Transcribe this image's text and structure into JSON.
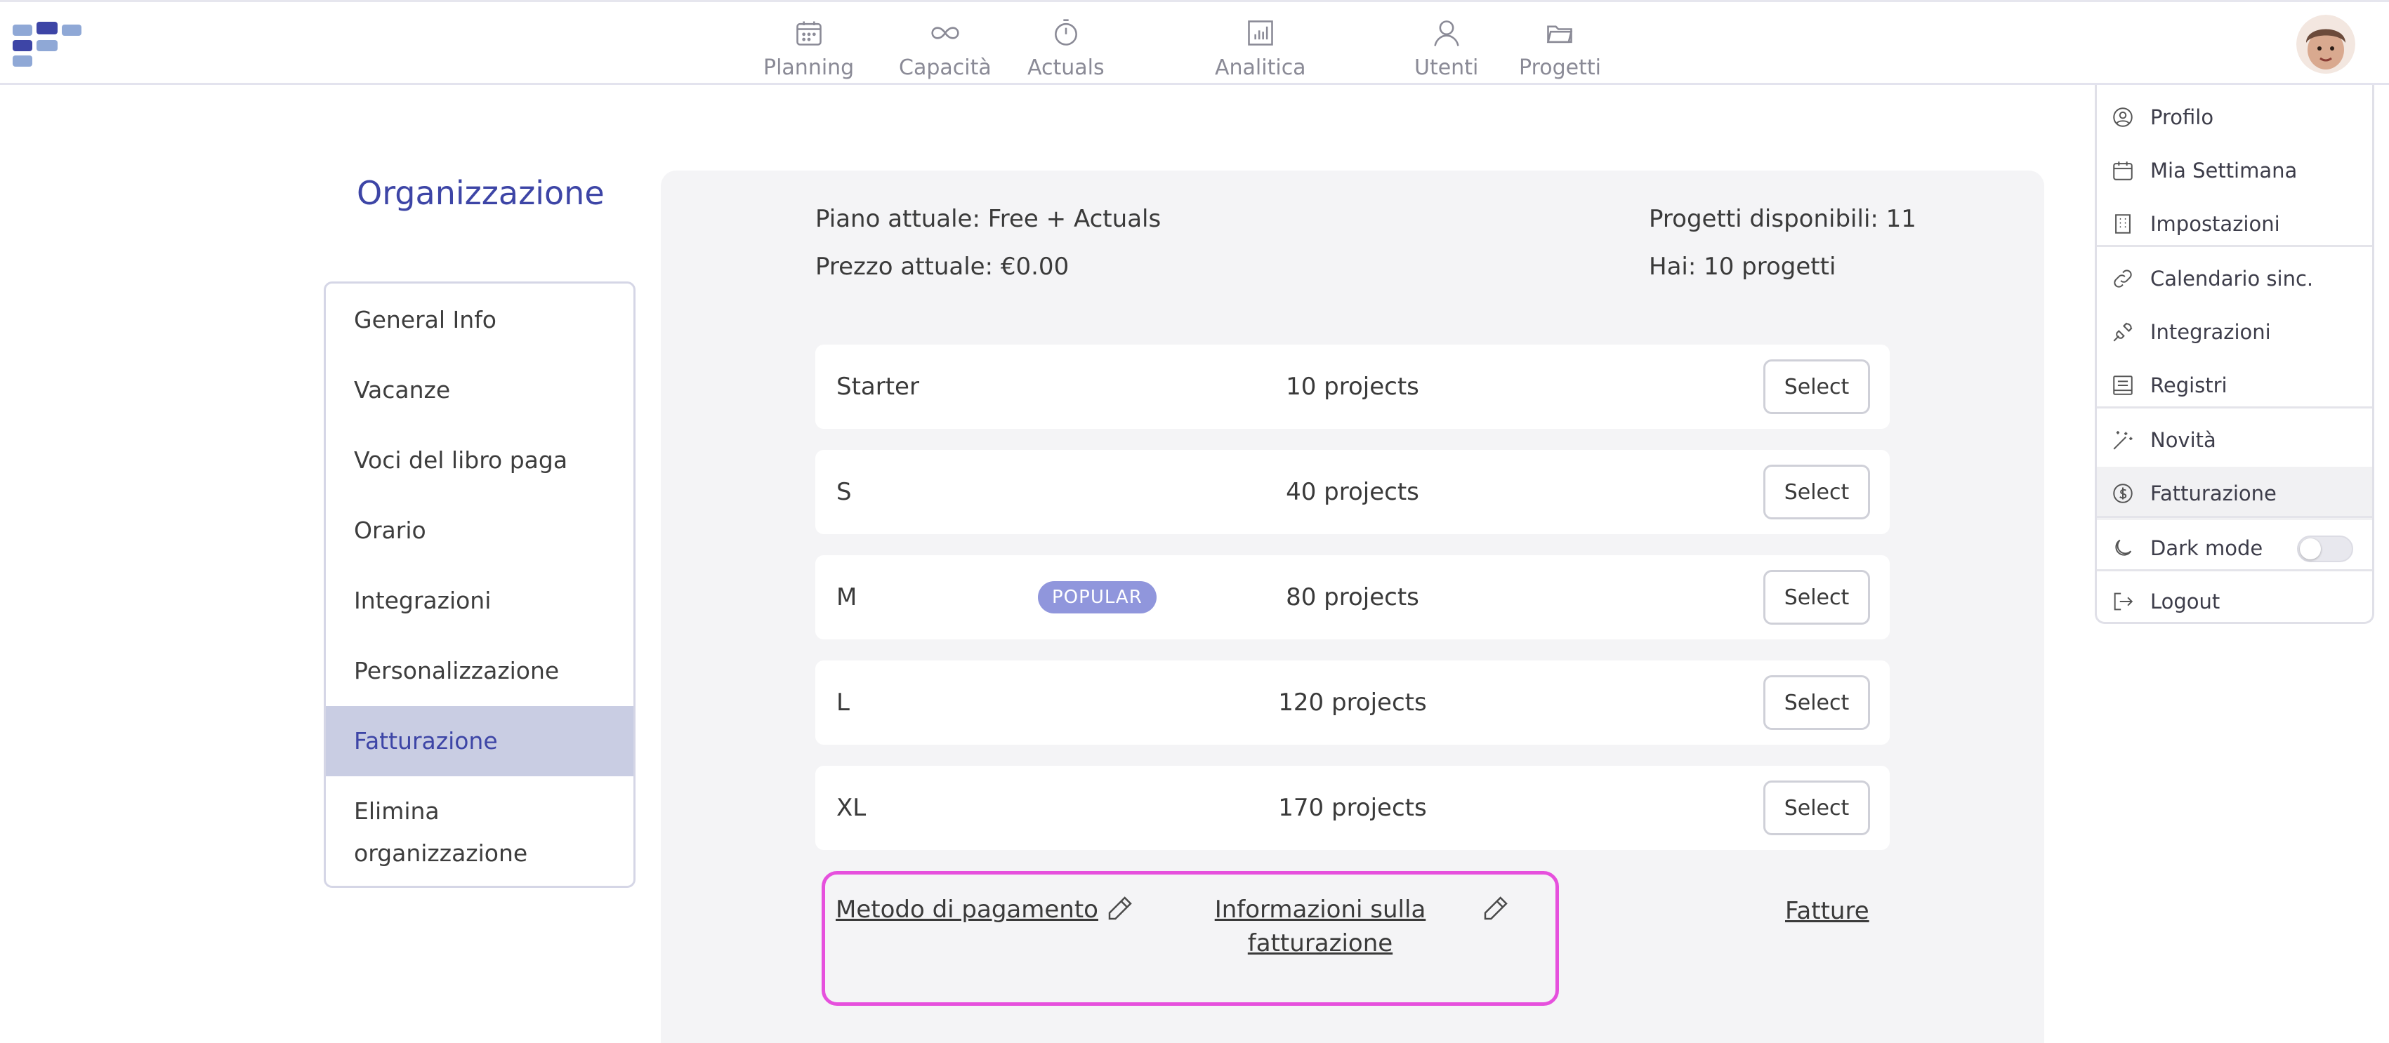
{
  "nav": {
    "items": [
      {
        "label": "Planning",
        "icon": "calendar-icon"
      },
      {
        "label": "Capacità",
        "icon": "infinity-icon"
      },
      {
        "label": "Actuals",
        "icon": "stopwatch-icon"
      },
      {
        "label": "Analitica",
        "icon": "bar-chart-icon"
      },
      {
        "label": "Utenti",
        "icon": "user-icon"
      },
      {
        "label": "Progetti",
        "icon": "folder-icon"
      }
    ]
  },
  "org": {
    "title": "Organizzazione",
    "menu": [
      {
        "label": "General Info"
      },
      {
        "label": "Vacanze"
      },
      {
        "label": "Voci del libro paga"
      },
      {
        "label": "Orario"
      },
      {
        "label": "Integrazioni"
      },
      {
        "label": "Personalizzazione"
      },
      {
        "label": "Fatturazione",
        "active": true
      },
      {
        "label": "Elimina organizzazione"
      }
    ]
  },
  "billing": {
    "current_plan": "Piano attuale: Free + Actuals",
    "current_price": "Prezzo attuale: €0.00",
    "available_projects": "Progetti disponibili: 11",
    "you_have": "Hai: 10 progetti",
    "plans": [
      {
        "name": "Starter",
        "projects": "10 projects",
        "button": "Select"
      },
      {
        "name": "S",
        "projects": "40 projects",
        "button": "Select"
      },
      {
        "name": "M",
        "projects": "80 projects",
        "button": "Select",
        "badge": "POPULAR"
      },
      {
        "name": "L",
        "projects": "120 projects",
        "button": "Select"
      },
      {
        "name": "XL",
        "projects": "170 projects",
        "button": "Select"
      }
    ],
    "payment_method": "Metodo di pagamento",
    "billing_info": "Informazioni sulla fatturazione",
    "invoices": "Fatture"
  },
  "dropdown": {
    "items": [
      {
        "label": "Profilo",
        "icon": "user-circle-icon"
      },
      {
        "label": "Mia Settimana",
        "icon": "calendar-icon"
      },
      {
        "label": "Impostazioni",
        "icon": "building-icon"
      },
      {
        "label": "Calendario sinc.",
        "icon": "link-icon"
      },
      {
        "label": "Integrazioni",
        "icon": "plug-icon"
      },
      {
        "label": "Registri",
        "icon": "log-icon"
      },
      {
        "label": "Novità",
        "icon": "magic-wand-icon"
      },
      {
        "label": "Fatturazione",
        "icon": "dollar-circle-icon",
        "active": true
      },
      {
        "label": "Dark mode",
        "icon": "moon-icon",
        "toggle": false
      },
      {
        "label": "Logout",
        "icon": "logout-icon"
      }
    ]
  },
  "colors": {
    "accent": "#3d45a6",
    "active_bg": "#c9cde3",
    "badge": "#9096dc",
    "highlight_border": "#e650dd",
    "panel_bg": "#f4f4f6"
  }
}
